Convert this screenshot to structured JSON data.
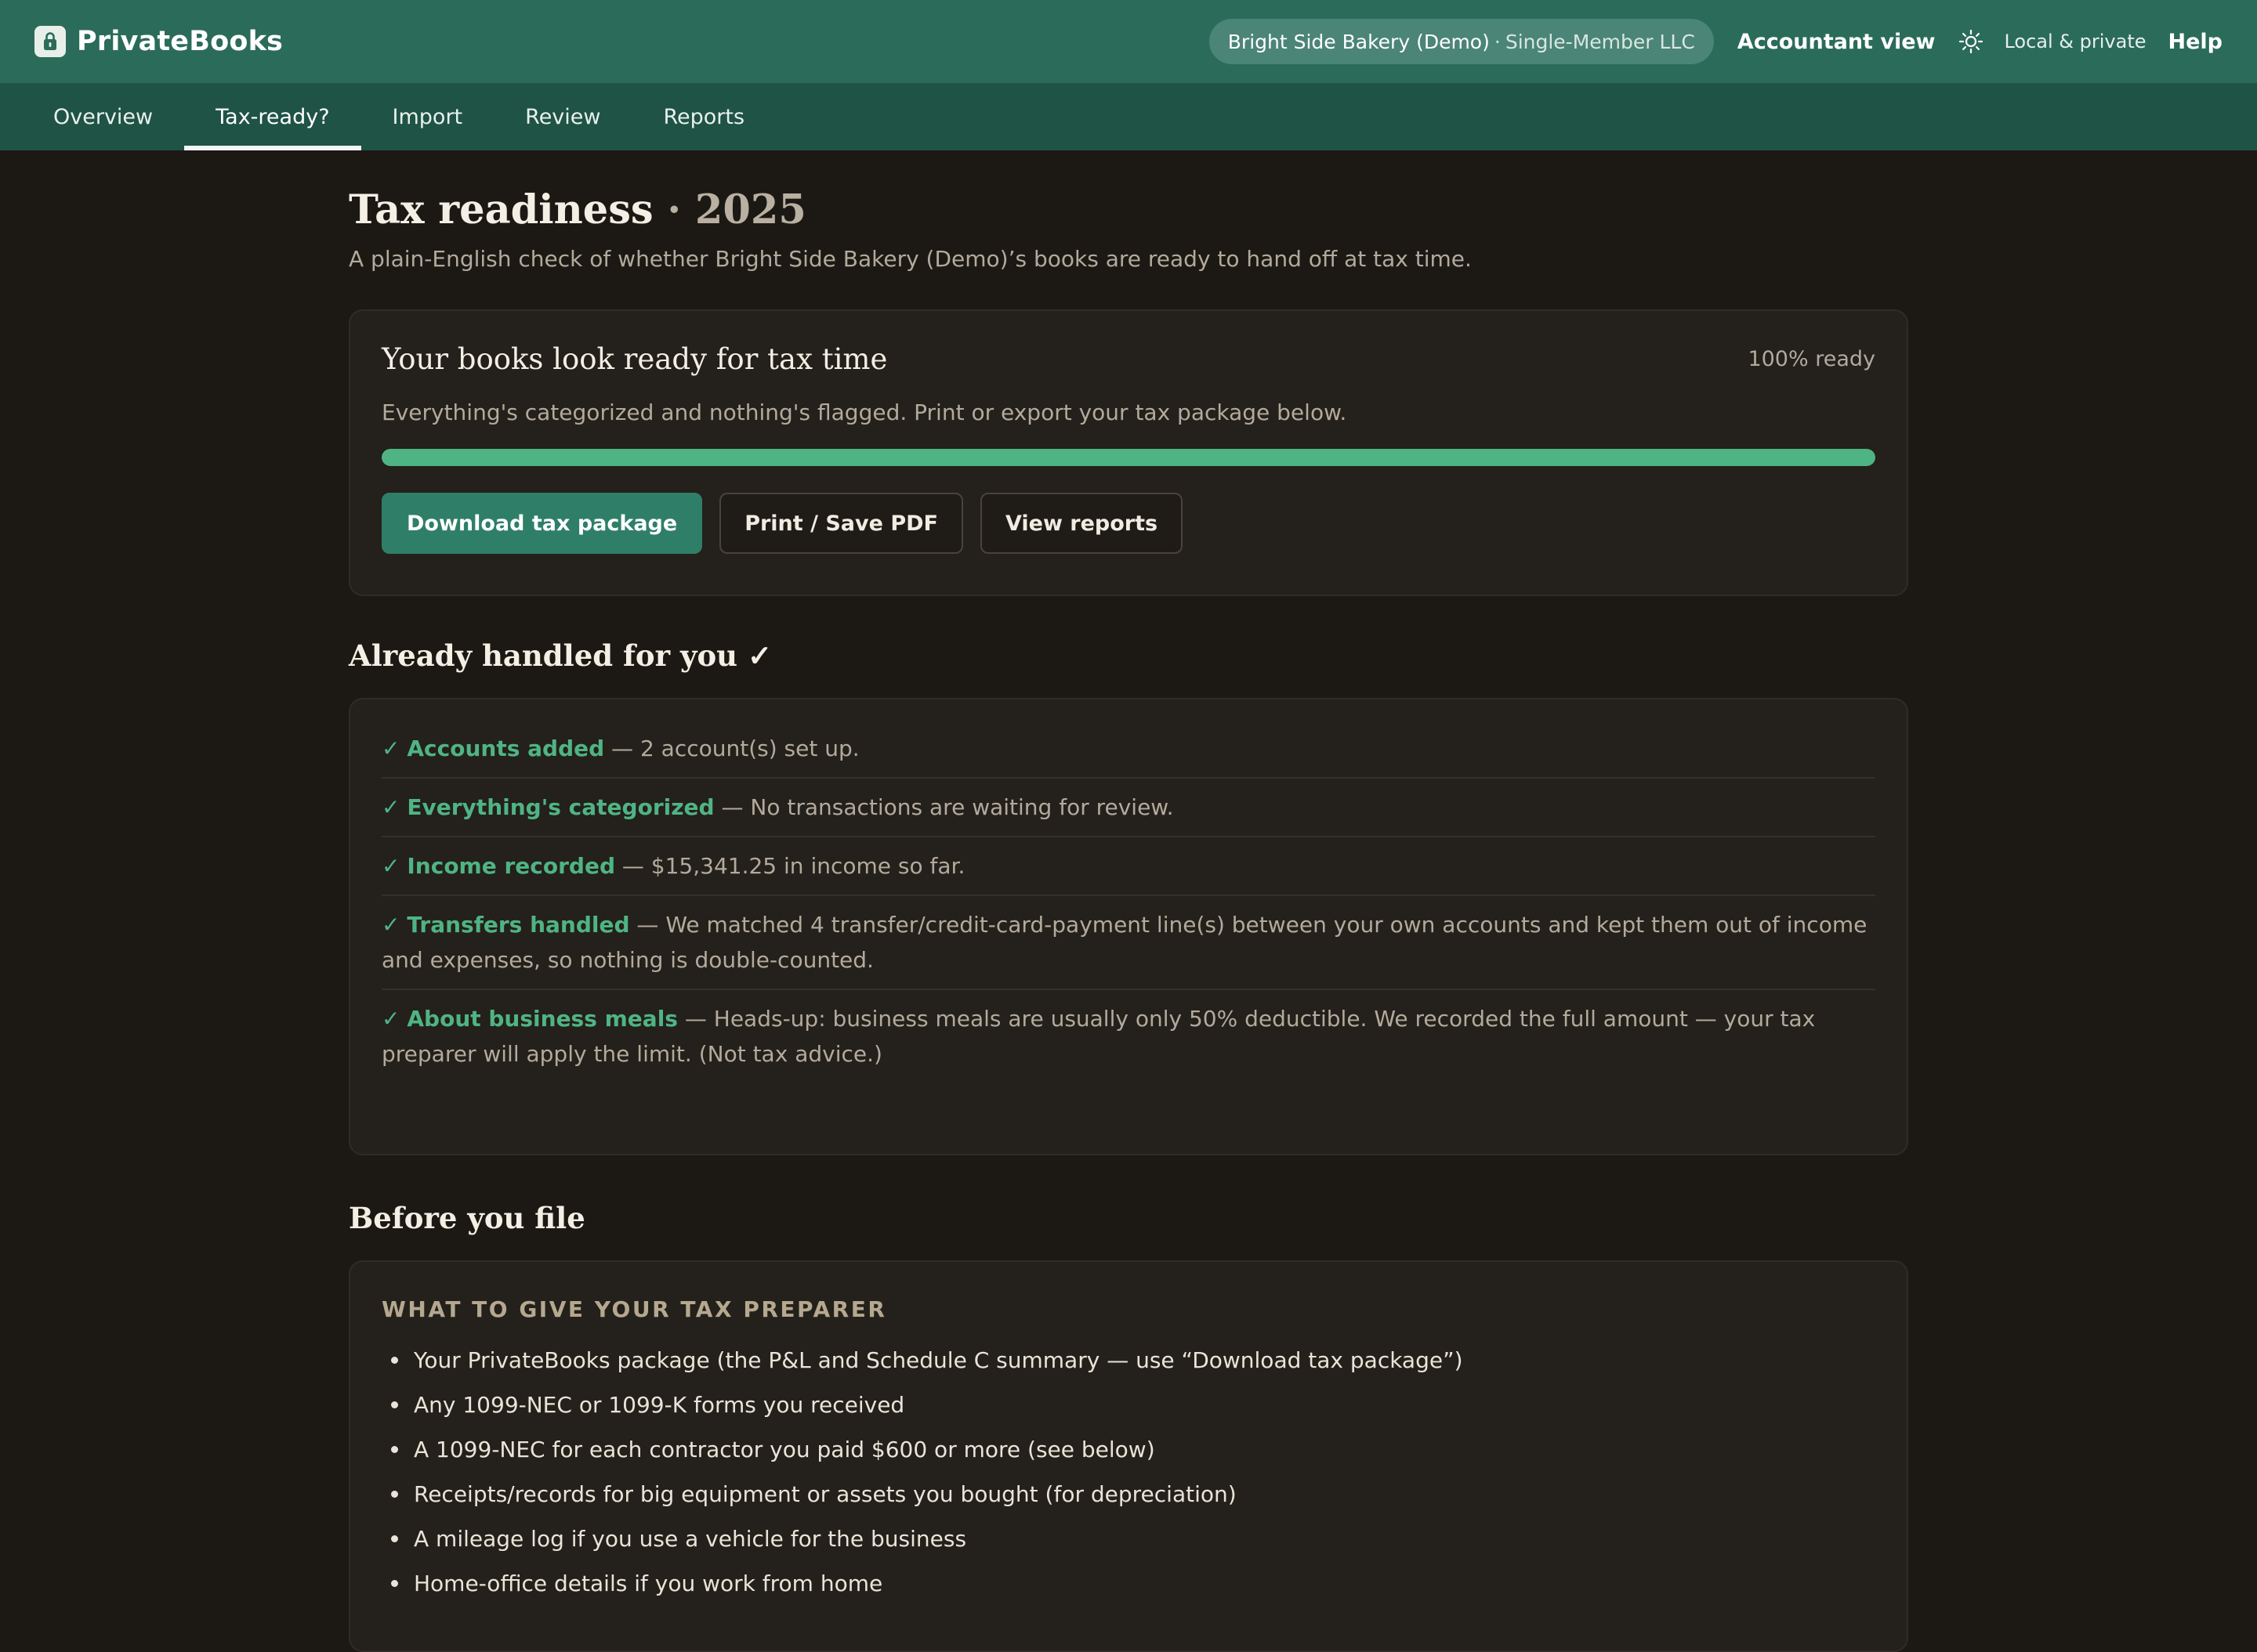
{
  "app": {
    "name": "PrivateBooks",
    "business_name": "Bright Side Bakery (Demo)",
    "business_separator": "·",
    "business_type": "Single-Member LLC",
    "accountant_view": "Accountant view",
    "privacy": "Local & private",
    "help": "Help",
    "theme_icon": "sun-icon",
    "brand_icon": "lock-icon"
  },
  "tabs": [
    {
      "label": "Overview",
      "active": false
    },
    {
      "label": "Tax-ready?",
      "active": true
    },
    {
      "label": "Import",
      "active": false
    },
    {
      "label": "Review",
      "active": false
    },
    {
      "label": "Reports",
      "active": false
    }
  ],
  "page": {
    "title": "Tax readiness",
    "title_separator": " · ",
    "year": "2025",
    "subtitle": "A plain-English check of whether Bright Side Bakery (Demo)’s books are ready to hand off at tax time."
  },
  "readiness": {
    "title": "Your books look ready for tax time",
    "percent_label": "100% ready",
    "progress_fraction": 1.0,
    "description": "Everything's categorized and nothing's flagged. Print or export your tax package below.",
    "buttons": {
      "download": "Download tax package",
      "print": "Print / Save PDF",
      "reports": "View reports"
    }
  },
  "handled": {
    "heading": "Already handled for you",
    "heading_mark": "✓",
    "items": [
      {
        "mark": "✓",
        "title": "Accounts added",
        "text": " — 2 account(s) set up."
      },
      {
        "mark": "✓",
        "title": "Everything's categorized",
        "text": " — No transactions are waiting for review."
      },
      {
        "mark": "✓",
        "title": "Income recorded",
        "text": " — $15,341.25 in income so far."
      },
      {
        "mark": "✓",
        "title": "Transfers handled",
        "text": " — We matched 4 transfer/credit-card-payment line(s) between your own accounts and kept them out of income and expenses, so nothing is double-counted."
      },
      {
        "mark": "✓",
        "title": "About business meals",
        "text": " — Heads-up: business meals are usually only 50% deductible. We recorded the full amount — your tax preparer will apply the limit. (Not tax advice.)"
      }
    ]
  },
  "before": {
    "heading": "Before you file",
    "label": "WHAT TO GIVE YOUR TAX PREPARER",
    "items": [
      "Your PrivateBooks package (the P&L and Schedule C summary — use “Download tax package”)",
      "Any 1099-NEC or 1099-K forms you received",
      "A 1099-NEC for each contractor you paid $600 or more (see below)",
      "Receipts/records for big equipment or assets you bought (for depreciation)",
      "A mileage log if you use a vehicle for the business",
      "Home-office details if you work from home"
    ]
  },
  "colors": {
    "header_bg": "#2b6b5a",
    "tabbar_bg": "#1f5345",
    "page_bg": "#1c1915",
    "accent_green": "#4fb484",
    "primary_button": "#2f7f68"
  }
}
